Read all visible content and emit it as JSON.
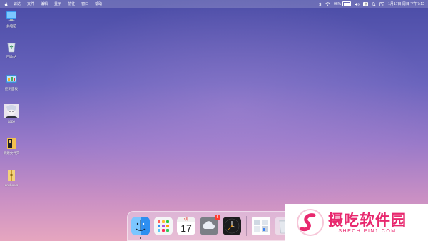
{
  "menubar": {
    "items": [
      "访达",
      "文件",
      "编辑",
      "显示",
      "前往",
      "窗口",
      "帮助"
    ],
    "battery": "96%",
    "clock": "1月17日 周日 下午7:12"
  },
  "desktop_icons": [
    {
      "label": "此电脑",
      "icon": "computer-icon"
    },
    {
      "label": "回收站",
      "icon": "recycle-bin-icon"
    },
    {
      "label": "控制面板",
      "icon": "control-panel-icon"
    },
    {
      "label": "appe",
      "icon": "anime-image-icon"
    },
    {
      "label": "新建文件夹",
      "icon": "folder-icon"
    },
    {
      "label": "anybotus",
      "icon": "folder-zip-icon"
    }
  ],
  "dock": {
    "calendar_month": "1月",
    "calendar_day": "17",
    "weather_badge": "5"
  },
  "watermark": {
    "cn": "摄吃软件园",
    "en": "SHECHIPIN1.COM"
  }
}
